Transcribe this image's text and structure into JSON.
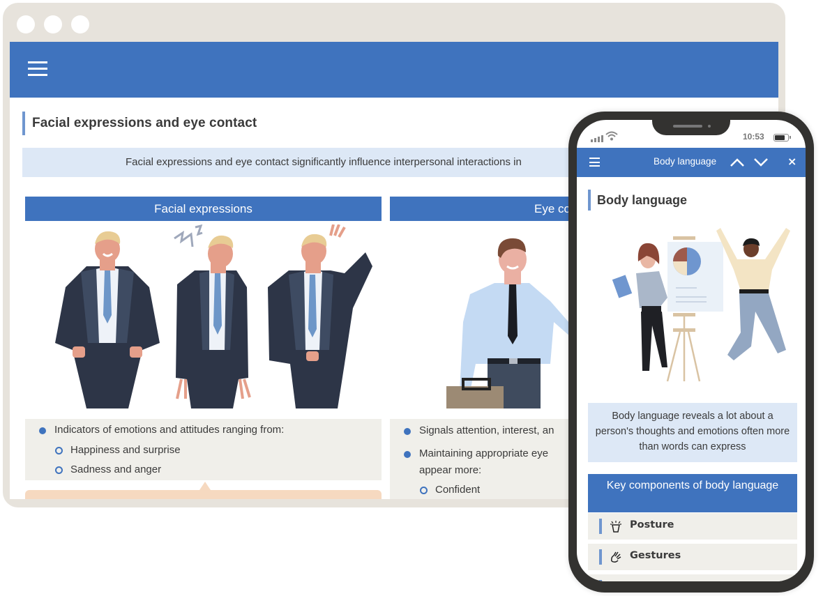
{
  "desktop": {
    "window_controls": [
      "dot",
      "dot",
      "dot"
    ],
    "menu_icon": "hamburger-icon",
    "page_title": "Facial expressions and eye contact",
    "intro_text": "Facial expressions and eye contact significantly influence interpersonal interactions in",
    "columns": [
      {
        "header": "Facial expressions",
        "illustration": "three businessmen showing happy, sad and stressed expressions",
        "bullets": [
          {
            "text": "Indicators of emotions and attitudes ranging from:",
            "sub": [
              "Happiness and surprise",
              "Sadness and anger"
            ]
          }
        ]
      },
      {
        "header": "Eye co",
        "illustration": "smiling businessman with briefcase waving",
        "bullets": [
          {
            "text": "Signals attention, interest, an",
            "sub": []
          },
          {
            "text": "Maintaining appropriate eye",
            "continuation": "appear more:",
            "sub": [
              "Confident"
            ]
          }
        ]
      }
    ]
  },
  "phone": {
    "status": {
      "time": "10:53",
      "signal_icon": "signal-icon",
      "wifi_icon": "wifi-icon",
      "battery_icon": "battery-icon"
    },
    "nav": {
      "menu_icon": "hamburger-icon",
      "title": "Body language",
      "prev_icon": "chevron-up-icon",
      "next_icon": "chevron-down-icon",
      "close_label": "×"
    },
    "heading": "Body language",
    "illustration": "woman presenting pie chart on easel next to jumping man",
    "intro_text": "Body language reveals a lot about a person's thoughts and emotions often more than words can express",
    "key_header": "Key components of body language",
    "items": [
      {
        "label": "Posture",
        "icon": "posture-icon"
      },
      {
        "label": "Gestures",
        "icon": "gestures-icon"
      },
      {
        "label": "",
        "icon": ""
      }
    ]
  },
  "colors": {
    "accent_blue": "#3f73be",
    "light_blue": "#dde8f6",
    "bar_blue": "#6f96cf",
    "panel_gray": "#f0efea",
    "callout_peach": "#f6d9c0",
    "frame_beige": "#e7e3dc",
    "phone_frame": "#333230"
  }
}
